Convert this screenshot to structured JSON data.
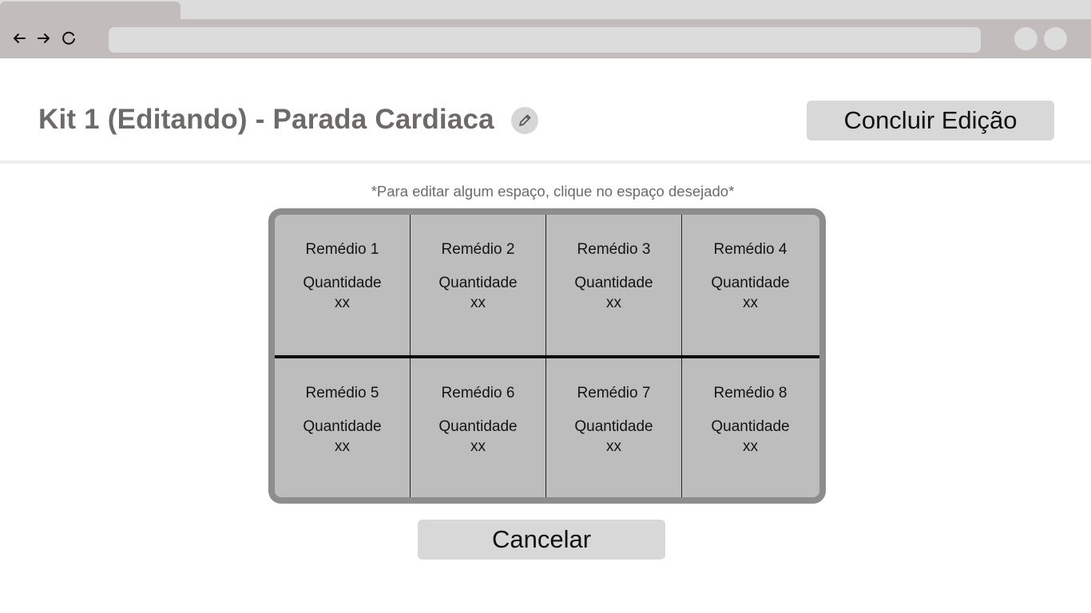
{
  "browser": {
    "back_icon": "arrow-left-icon",
    "forward_icon": "arrow-right-icon",
    "reload_icon": "reload-icon",
    "address": ""
  },
  "header": {
    "title": "Kit 1 (Editando) - Parada Cardiaca",
    "edit_icon": "pencil-icon",
    "finish_label": "Concluir Edição"
  },
  "hint": "*Para editar algum espaço, clique no espaço desejado*",
  "kit": {
    "slots": [
      {
        "name": "Remédio 1",
        "qty_label": "Quantidade",
        "qty": "xx"
      },
      {
        "name": "Remédio 2",
        "qty_label": "Quantidade",
        "qty": "xx"
      },
      {
        "name": "Remédio 3",
        "qty_label": "Quantidade",
        "qty": "xx"
      },
      {
        "name": "Remédio 4",
        "qty_label": "Quantidade",
        "qty": "xx"
      },
      {
        "name": "Remédio 5",
        "qty_label": "Quantidade",
        "qty": "xx"
      },
      {
        "name": "Remédio 6",
        "qty_label": "Quantidade",
        "qty": "xx"
      },
      {
        "name": "Remédio 7",
        "qty_label": "Quantidade",
        "qty": "xx"
      },
      {
        "name": "Remédio 8",
        "qty_label": "Quantidade",
        "qty": "xx"
      }
    ]
  },
  "footer": {
    "cancel_label": "Cancelar"
  },
  "colors": {
    "chrome": "#c2bcbc",
    "title": "#6e6a6a",
    "button": "#d8d8d8",
    "slot": "#bdbdbd",
    "frame": "#8d8d8d"
  }
}
